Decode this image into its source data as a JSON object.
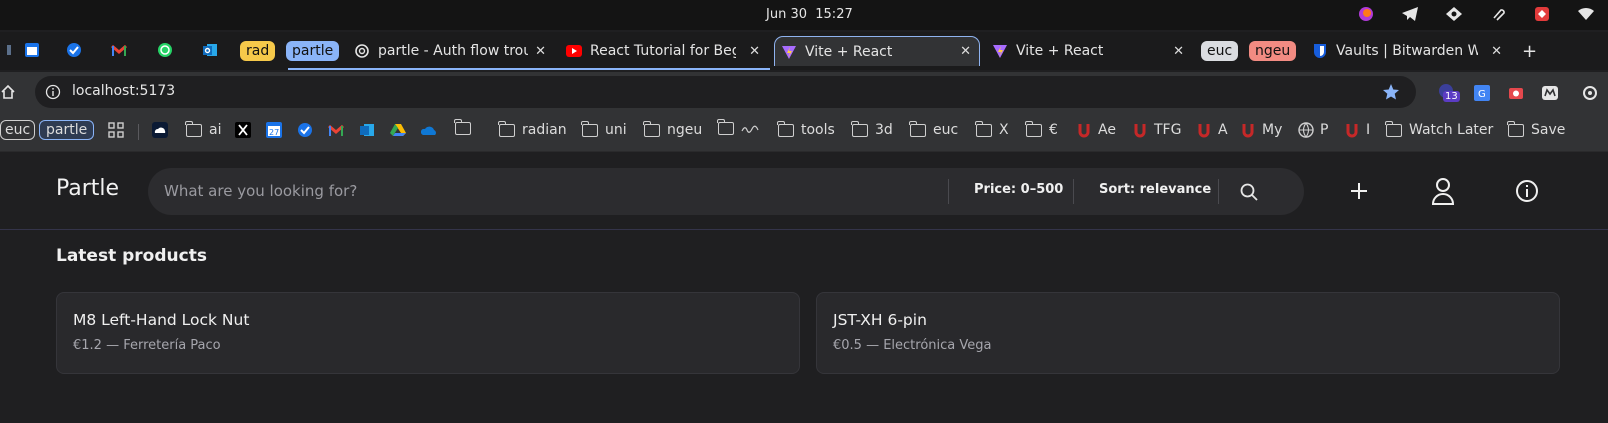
{
  "system_bar": {
    "date": "Jun 30",
    "time": "15:27"
  },
  "tabs": {
    "chips": [
      "rad",
      "partle",
      "euc",
      "ngeu"
    ],
    "items": [
      {
        "title": "partle - Auth flow trou",
        "favicon": "openai-icon"
      },
      {
        "title": "React Tutorial for Beg",
        "favicon": "youtube-icon"
      },
      {
        "title": "Vite + React",
        "favicon": "vite-icon"
      },
      {
        "title": "Vite + React",
        "favicon": "vite-icon"
      },
      {
        "title": "Vaults | Bitwarden We",
        "favicon": "bitwarden-icon"
      }
    ],
    "new_tab": "+"
  },
  "address_bar": {
    "url": "localhost:5173",
    "extension_badge": "13"
  },
  "bookmarks": {
    "chips": [
      "euc",
      "partle"
    ],
    "items": [
      "ai",
      "radian",
      "uni",
      "ngeu",
      "tools",
      "3d",
      "euc",
      "X",
      "€",
      "Ae",
      "TFG",
      "A",
      "My",
      "P",
      "I",
      "Watch Later",
      "Save"
    ],
    "calendar_day": "27"
  },
  "app": {
    "brand": "Partle",
    "search": {
      "placeholder": "What are you looking for?"
    },
    "price_filter": "Price: 0–500",
    "sort_filter": "Sort: relevance",
    "section_title": "Latest products",
    "products": [
      {
        "name": "M8 Left-Hand Lock Nut",
        "meta": "€1.2 — Ferretería Paco"
      },
      {
        "name": "JST-XH 6-pin",
        "meta": "€0.5 — Electrónica Vega"
      }
    ]
  },
  "colors": {
    "app_bg": "#1f1f21",
    "chip_rad": "#f6c94a",
    "chip_partle": "#8ab4f8",
    "chip_euc": "#dadce0",
    "chip_ngeu": "#f28b82",
    "active_tab_border": "#8fb3f0"
  }
}
